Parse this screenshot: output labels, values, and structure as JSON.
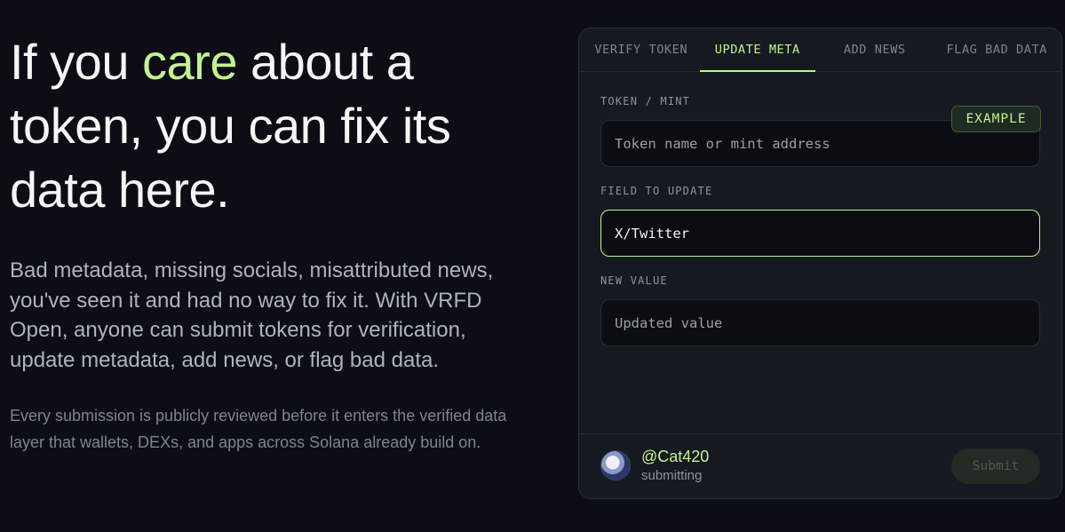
{
  "hero": {
    "headline_before": "If you ",
    "headline_accent": "care",
    "headline_after": " about a token, you can fix its data here.",
    "lead": "Bad metadata, missing socials, misattributed news, you've seen it and had no way to fix it. With VRFD Open, anyone can submit tokens for verification, update metadata, add news, or flag bad data.",
    "fine": "Every submission is publicly reviewed before it enters the verified data layer that wallets, DEXs, and apps across Solana already build on."
  },
  "panel": {
    "tabs": [
      {
        "label": "VERIFY TOKEN",
        "active": false
      },
      {
        "label": "UPDATE META",
        "active": true
      },
      {
        "label": "ADD NEWS",
        "active": false
      },
      {
        "label": "FLAG BAD DATA",
        "active": false
      }
    ],
    "example_badge": "EXAMPLE",
    "fields": {
      "token": {
        "label": "TOKEN / MINT",
        "placeholder": "Token name or mint address",
        "value": ""
      },
      "field_to_update": {
        "label": "FIELD TO UPDATE",
        "value": "X/Twitter"
      },
      "new_value": {
        "label": "NEW VALUE",
        "placeholder": "Updated value",
        "value": ""
      }
    },
    "footer": {
      "handle": "@Cat420",
      "role": "submitting",
      "submit_label": "Submit",
      "submit_disabled": true
    }
  },
  "colors": {
    "background": "#0b0e14",
    "accent": "#c8f08f",
    "panel": "#151a21"
  },
  "icons": {
    "avatar": "cat-avatar-icon"
  }
}
